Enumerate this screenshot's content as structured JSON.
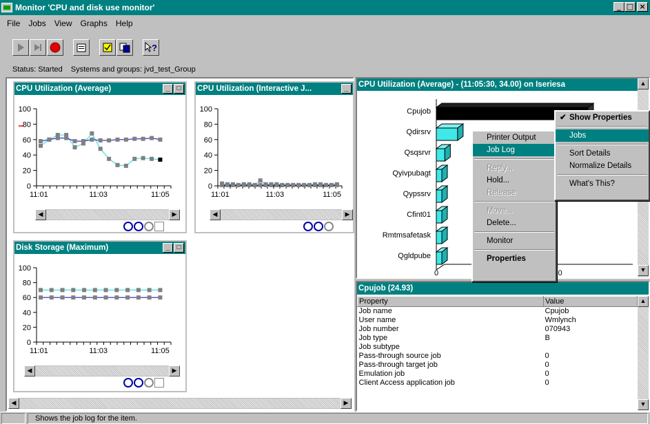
{
  "window": {
    "title": "Monitor 'CPU and disk use monitor'"
  },
  "menu": [
    "File",
    "Jobs",
    "View",
    "Graphs",
    "Help"
  ],
  "status": {
    "label": "Status: Started",
    "systems": "Systems and groups: jvd_test_Group"
  },
  "panels": {
    "cpu_avg": {
      "title": "CPU Utilization (Average)"
    },
    "cpu_inter": {
      "title": "CPU Utilization (Interactive J..."
    },
    "disk": {
      "title": "Disk Storage (Maximum)"
    },
    "detail_chart": {
      "title": "CPU Utilization (Average) - (11:05:30, 34.00) on Iseriesa"
    },
    "props": {
      "title": "Cpujob (24.93)"
    }
  },
  "axis": {
    "y": [
      "100",
      "80",
      "60",
      "40",
      "20",
      "0"
    ],
    "x": [
      "11:01",
      "11:03",
      "11:05"
    ]
  },
  "chart_data": [
    {
      "type": "line",
      "title": "CPU Utilization (Average)",
      "x": [
        "11:01",
        "",
        "",
        "",
        "",
        "",
        "",
        "",
        "",
        "",
        "",
        "11:05"
      ],
      "ylim": [
        0,
        100
      ],
      "series": [
        {
          "values": [
            52,
            60,
            66,
            66,
            50,
            55,
            68,
            48,
            35,
            27,
            26,
            35,
            36,
            35,
            34
          ]
        },
        {
          "values": [
            58,
            60,
            62,
            62,
            58,
            58,
            60,
            59,
            59,
            60,
            60,
            61,
            61,
            62,
            60
          ]
        }
      ]
    },
    {
      "type": "line",
      "title": "CPU Utilization (Interactive J...",
      "ylim": [
        0,
        100
      ],
      "series": [
        {
          "values": [
            3,
            2,
            2,
            1,
            2,
            2,
            1,
            7,
            2,
            2,
            2,
            1,
            1,
            1,
            1,
            1,
            1,
            2,
            2,
            1,
            1,
            2
          ]
        },
        {
          "values": [
            1,
            1,
            1,
            1,
            1,
            1,
            1,
            1,
            1,
            1,
            1,
            1,
            1,
            1,
            1,
            1,
            1,
            1,
            1,
            1,
            1,
            1
          ]
        }
      ]
    },
    {
      "type": "line",
      "title": "Disk Storage (Maximum)",
      "ylim": [
        0,
        100
      ],
      "series": [
        {
          "values": [
            70,
            70,
            70,
            70,
            70,
            70,
            70,
            70,
            70,
            70,
            70,
            70
          ]
        },
        {
          "values": [
            60,
            60,
            60,
            60,
            60,
            60,
            60,
            60,
            60,
            60,
            60,
            60
          ]
        }
      ]
    },
    {
      "type": "bar",
      "title": "CPU Utilization (Average) - (11:05:30, 34.00) on Iseriesa",
      "categories": [
        "Cpujob",
        "Qdirsrv",
        "Qsqsrvr",
        "Qyivpubagt",
        "Qypssrv",
        "Cfint01",
        "Rmtmsafetask",
        "Qgldpube"
      ],
      "values": [
        24.93,
        3.5,
        1.4,
        0.9,
        0.8,
        0.8,
        0.8,
        0.8
      ],
      "xticks": [
        "0",
        "20"
      ]
    }
  ],
  "context_menu": {
    "items": [
      "Printer Output",
      "Job Log",
      "Reply...",
      "Hold...",
      "Release",
      "Move...",
      "Delete...",
      "Monitor",
      "Properties"
    ]
  },
  "graph_menu": {
    "items": [
      "Show Properties",
      "Jobs",
      "Sort Details",
      "Normalize Details",
      "What's This?"
    ]
  },
  "properties": {
    "headers": [
      "Property",
      "Value"
    ],
    "rows": [
      [
        "Job name",
        "Cpujob"
      ],
      [
        "User name",
        "Wmlynch"
      ],
      [
        "Job number",
        "070943"
      ],
      [
        "Job type",
        "B"
      ],
      [
        "Job subtype",
        ""
      ],
      [
        "Pass-through source job",
        "0"
      ],
      [
        "Pass-through target job",
        "0"
      ],
      [
        "Emulation job",
        "0"
      ],
      [
        "Client Access application job",
        "0"
      ]
    ]
  },
  "statusbar": {
    "text": "Shows the job log for the item."
  }
}
